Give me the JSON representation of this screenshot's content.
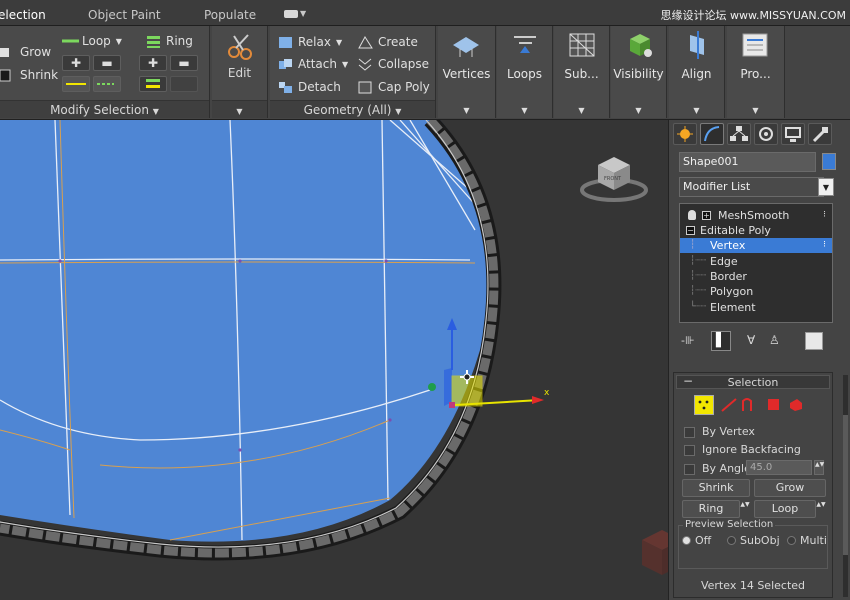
{
  "top_tabs": {
    "selection": "election",
    "object_paint": "Object Paint",
    "populate": "Populate"
  },
  "watermark_top": "思缘设计论坛 www.MISSYUAN.COM",
  "ribbon": {
    "modify_selection": {
      "grow": "Grow",
      "shrink": "Shrink",
      "loop": "Loop",
      "ring": "Ring",
      "footer": "Modify Selection"
    },
    "edit": {
      "label": "Edit"
    },
    "geometry": {
      "relax": "Relax",
      "create": "Create",
      "attach": "Attach",
      "collapse": "Collapse",
      "detach": "Detach",
      "cap_poly": "Cap Poly",
      "footer": "Geometry (All)"
    },
    "big_buttons": {
      "vertices": "Vertices",
      "loops": "Loops",
      "sub": "Sub...",
      "visibility": "Visibility",
      "align": "Align",
      "pro": "Pro..."
    }
  },
  "viewcube": {
    "face_label": "FRONT"
  },
  "gizmo": {
    "x_axis": "x"
  },
  "command_panel": {
    "object_name": "Shape001",
    "object_color": "#3a7bd5",
    "modifier_list": "Modifier List",
    "stack": {
      "meshsmooth": "MeshSmooth",
      "editable_poly": "Editable Poly",
      "vertex": "Vertex",
      "edge": "Edge",
      "border": "Border",
      "polygon": "Polygon",
      "element": "Element"
    },
    "selection": {
      "title": "Selection",
      "by_vertex": "By Vertex",
      "ignore_backfacing": "Ignore Backfacing",
      "by_angle": "By Angle:",
      "angle_value": "45.0",
      "shrink": "Shrink",
      "grow": "Grow",
      "ring": "Ring",
      "loop": "Loop",
      "preview_title": "Preview Selection",
      "preview_off": "Off",
      "preview_subobj": "SubObj",
      "preview_multi": "Multi",
      "status": "Vertex 14 Selected"
    }
  },
  "colors": {
    "viewport_bg": "#353535",
    "mesh_fill": "#4f86d4",
    "selection_blue": "#3a7bd5",
    "accent_yellow": "#f2e600"
  }
}
